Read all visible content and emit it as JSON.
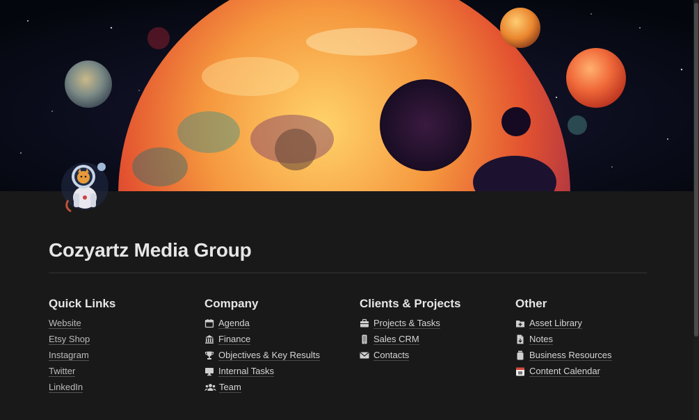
{
  "page": {
    "title": "Cozyartz Media Group"
  },
  "cover": {
    "description_icon": "space-planets-cover"
  },
  "avatar": {
    "icon": "astronaut-cat-icon"
  },
  "columns": [
    {
      "heading": "Quick Links",
      "items": [
        {
          "label": "Website"
        },
        {
          "label": "Etsy Shop"
        },
        {
          "label": "Instagram"
        },
        {
          "label": "Twitter"
        },
        {
          "label": "LinkedIn"
        }
      ]
    },
    {
      "heading": "Company",
      "items": [
        {
          "label": "Agenda",
          "icon": "calendar-icon"
        },
        {
          "label": "Finance",
          "icon": "bank-icon"
        },
        {
          "label": "Objectives & Key Results",
          "icon": "trophy-icon"
        },
        {
          "label": "Internal Tasks",
          "icon": "monitor-icon"
        },
        {
          "label": "Team",
          "icon": "people-icon"
        }
      ]
    },
    {
      "heading": "Clients & Projects",
      "items": [
        {
          "label": "Projects & Tasks",
          "icon": "briefcase-icon"
        },
        {
          "label": "Sales CRM",
          "icon": "phone-icon"
        },
        {
          "label": "Contacts",
          "icon": "envelope-icon"
        }
      ]
    },
    {
      "heading": "Other",
      "items": [
        {
          "label": "Asset Library",
          "icon": "folder-plus-icon"
        },
        {
          "label": "Notes",
          "icon": "document-icon"
        },
        {
          "label": "Business Resources",
          "icon": "jar-icon"
        },
        {
          "label": "Content Calendar",
          "icon": "date-calendar-icon"
        }
      ]
    }
  ]
}
